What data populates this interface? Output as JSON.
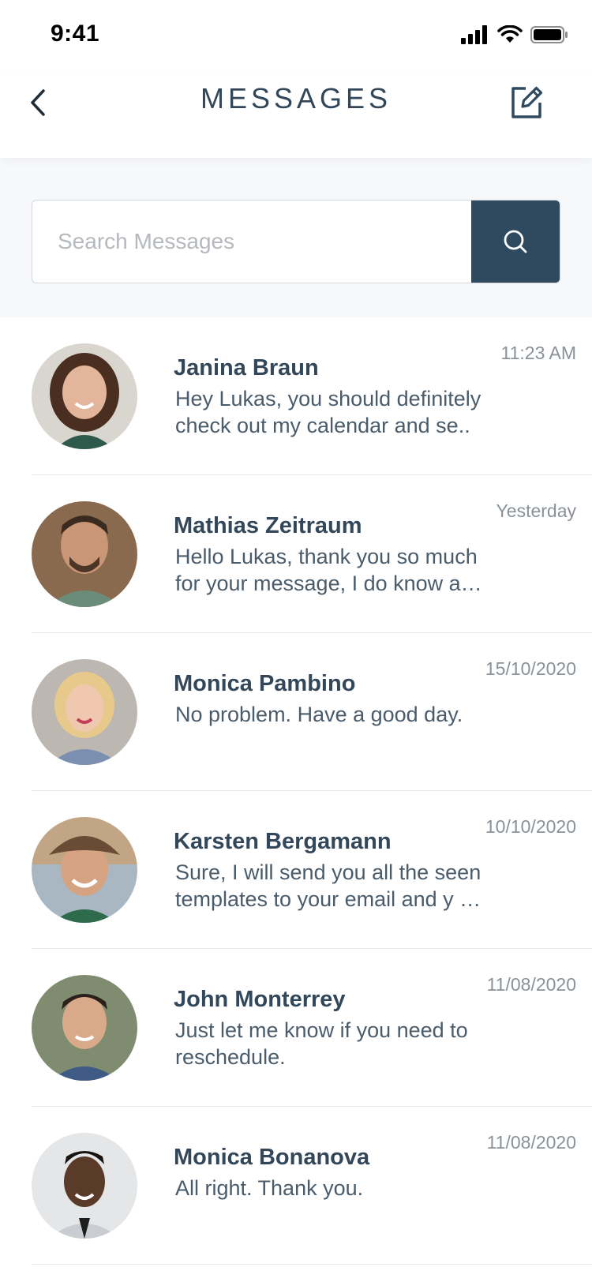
{
  "status_bar": {
    "time": "9:41"
  },
  "nav": {
    "title": "MESSAGES"
  },
  "search": {
    "placeholder": "Search Messages",
    "value": ""
  },
  "messages": [
    {
      "name": "Janina Braun",
      "time": "11:23 AM",
      "preview": "Hey Lukas, you should definitely\ncheck out my calendar and se.."
    },
    {
      "name": "Mathias Zeitraum",
      "time": "Yesterday",
      "preview": "Hello Lukas, thank you so much\nfor your message, I do know a…"
    },
    {
      "name": "Monica Pambino",
      "time": "15/10/2020",
      "preview": "No problem. Have a good day."
    },
    {
      "name": "Karsten Bergamann",
      "time": "10/10/2020",
      "preview": "Sure, I will send you all the seen\ntemplates to your email and y …"
    },
    {
      "name": "John Monterrey",
      "time": "11/08/2020",
      "preview": "Just let me know if you need to\nreschedule."
    },
    {
      "name": "Monica Bonanova",
      "time": "11/08/2020",
      "preview": "All right. Thank you."
    }
  ],
  "colors": {
    "primary": "#2f4a5e",
    "divider": "#e6e8ea",
    "search_bg": "#f7f8f9"
  }
}
